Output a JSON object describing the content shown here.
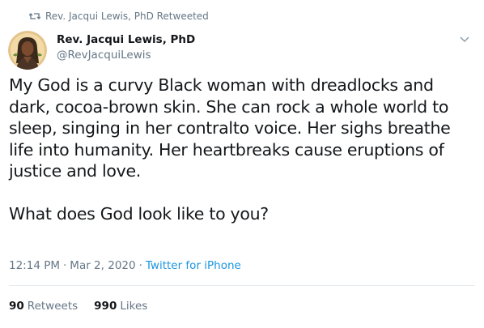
{
  "retweet_context": {
    "icon": "retweet-icon",
    "text": "Rev. Jacqui Lewis, PhD Retweeted"
  },
  "author": {
    "name": "Rev. Jacqui Lewis, PhD",
    "handle": "@RevJacquiLewis",
    "avatar_icon": "avatar-portrait"
  },
  "menu": {
    "icon": "chevron-down-icon"
  },
  "tweet": {
    "text": "My God is a curvy Black woman with dreadlocks and dark, cocoa-brown skin. She can rock a whole world to sleep, singing in her contralto voice. Her sighs breathe life into humanity. Her heartbreaks cause eruptions of justice and love.\n\nWhat does God look like to you?",
    "time": "12:14 PM",
    "date": "Mar 2, 2020",
    "separator": "·",
    "source": "Twitter for iPhone"
  },
  "stats": {
    "retweets_count": "90",
    "retweets_label": "Retweets",
    "likes_count": "990",
    "likes_label": "Likes"
  },
  "colors": {
    "text": "#14171a",
    "secondary": "#657786",
    "link": "#1b95e0",
    "divider": "#e6ecf0"
  }
}
